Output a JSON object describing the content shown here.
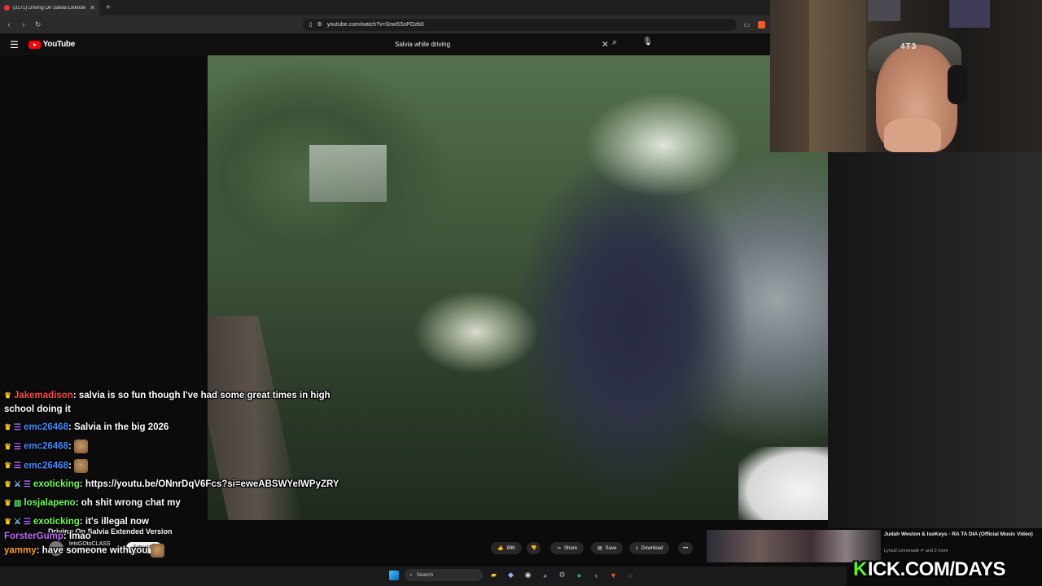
{
  "browser": {
    "tab_title": "(3171) Driving On Salvia Extende",
    "new_tab": "+",
    "url": "youtube.com/watch?v=Snw5SsPOzb0"
  },
  "youtube": {
    "logo_text": "YouTube",
    "search_query": "Salvia while driving"
  },
  "video": {
    "title": "Driving On Salvia Extended Version",
    "channel_name": "letsGOtoCLASS",
    "channel_subs": "subscribers",
    "subscribe_label": "Subscribe",
    "like_count": "89K",
    "share_label": "Share",
    "save_label": "Save",
    "download_label": "Download",
    "more_label": "•••"
  },
  "recommendation": {
    "title": "Judah Weston & IsoKeys - RA TA DIA (Official Music Video)",
    "channel": "Lyrical Lemonade ✔ and 2 more"
  },
  "webcam": {
    "hat_text": "4T3"
  },
  "kick_banner": {
    "k": "K",
    "text": "ICK.COM/DAYS"
  },
  "taskbar": {
    "search_label": "Search"
  },
  "chat": [
    {
      "user": "Jakemadison",
      "color": "#ff4a4a",
      "text": "salvia is so fun though I've had some great times in high school doing it"
    },
    {
      "user": "emc26468",
      "color": "#3d8cff",
      "text": "Salvia in the big 2026"
    },
    {
      "user": "emc26468",
      "color": "#3d8cff",
      "text": ""
    },
    {
      "user": "emc26468",
      "color": "#3d8cff",
      "text": ""
    },
    {
      "user": "exoticking",
      "color": "#6cff4a",
      "text": "https://youtu.be/ONnrDqV6Fcs?si=eweABSWYeIWPyZRY"
    },
    {
      "user": "losjalapeno",
      "color": "#6cff4a",
      "text": "oh shit wrong chat my"
    },
    {
      "user": "exoticking",
      "color": "#6cff4a",
      "text": "it's illegal now"
    },
    {
      "user": "ForsterGump",
      "color": "#c26cff",
      "text": "lmao"
    },
    {
      "user": "yammy",
      "color": "#f7a21b",
      "text": "have someone with you"
    }
  ]
}
